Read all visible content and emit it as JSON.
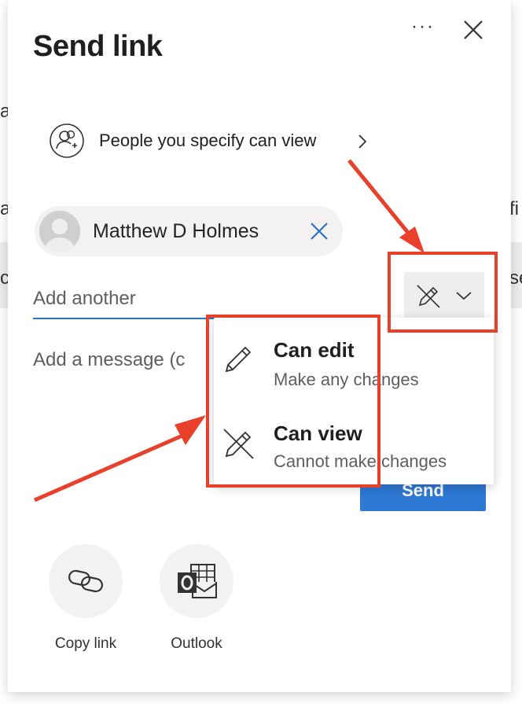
{
  "background": {
    "frag_left_1": "a",
    "frag_left_2": "a",
    "frag_left_3": "c",
    "frag_right_1": "fi",
    "frag_right_2": "se"
  },
  "dialog": {
    "title": "Send link",
    "more_label": "···",
    "permission_summary": "People you specify can view",
    "recipient": {
      "name": "Matthew D Holmes"
    },
    "add_another_placeholder": "Add another",
    "message_placeholder": "Add a message (c",
    "send_label": "Send",
    "permission_menu": [
      {
        "title": "Can edit",
        "subtitle": "Make any changes",
        "icon": "pencil-icon"
      },
      {
        "title": "Can view",
        "subtitle": "Cannot make changes",
        "icon": "pencil-crossed-icon"
      }
    ],
    "share_options": [
      {
        "label": "Copy link",
        "icon": "link-icon"
      },
      {
        "label": "Outlook",
        "icon": "outlook-icon"
      }
    ]
  },
  "colors": {
    "accent": "#2f79d6",
    "annotation": "#e8402a",
    "chip_bg": "#f3f2f1"
  }
}
